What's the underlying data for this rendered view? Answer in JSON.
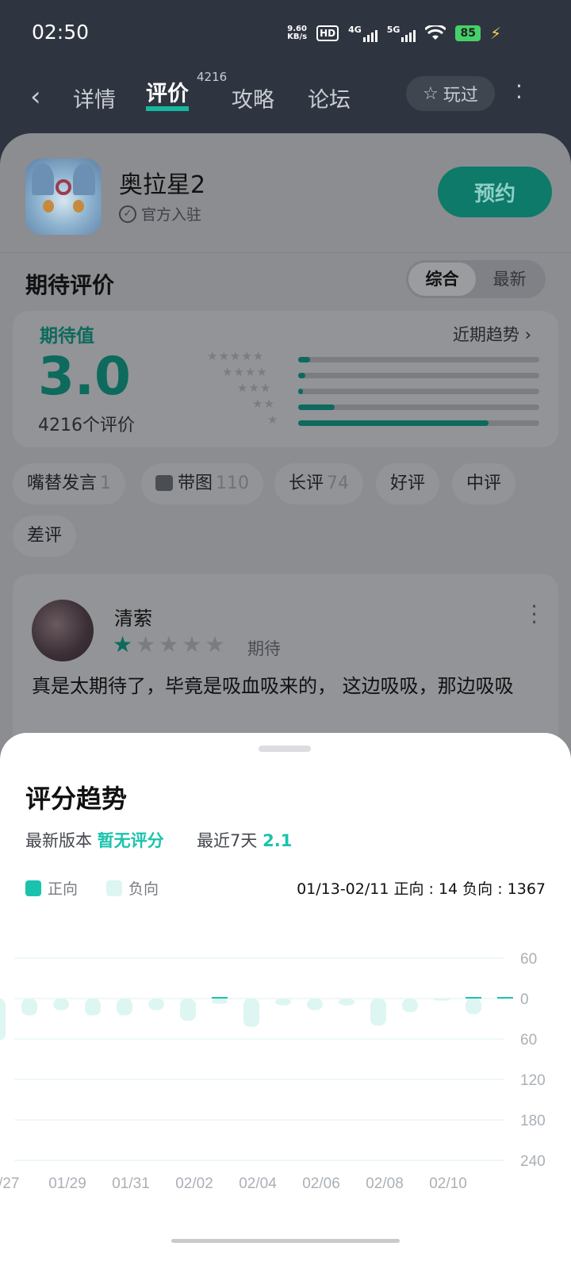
{
  "status": {
    "time": "02:50",
    "speed_value": "9.60",
    "speed_unit": "KB/s",
    "hd": "HD",
    "sim1": "4G",
    "sim2": "5G",
    "battery": "85"
  },
  "nav": {
    "tabs": [
      "详情",
      "评价",
      "攻略",
      "论坛"
    ],
    "active_tab": "评价",
    "review_count": "4216",
    "played_label": "玩过"
  },
  "game": {
    "name": "奥拉星2",
    "official": "官方入驻",
    "reserve_label": "预约"
  },
  "section": {
    "title": "期待评价",
    "sort_options": [
      "综合",
      "最新"
    ],
    "active_sort": "综合"
  },
  "rating": {
    "label": "期待值",
    "score": "3.0",
    "count_text": "4216个评价",
    "trend_link": "近期趋势",
    "distribution": [
      {
        "stars": 5,
        "fraction": 0.05
      },
      {
        "stars": 4,
        "fraction": 0.03
      },
      {
        "stars": 3,
        "fraction": 0.02
      },
      {
        "stars": 2,
        "fraction": 0.15
      },
      {
        "stars": 1,
        "fraction": 0.79
      }
    ]
  },
  "filters": [
    {
      "label": "嘴替发言",
      "count": "1"
    },
    {
      "label": "带图",
      "count": "110",
      "icon": "image-icon"
    },
    {
      "label": "长评",
      "count": "74"
    },
    {
      "label": "好评",
      "count": ""
    },
    {
      "label": "中评",
      "count": ""
    },
    {
      "label": "差评",
      "count": ""
    }
  ],
  "review": {
    "user": "清萦",
    "stars": 1,
    "tag": "期待",
    "text": "真是太期待了，毕竟是吸血吸来的， 这边吸吸，那边吸吸"
  },
  "sheet": {
    "title": "评分趋势",
    "latest_label": "最新版本",
    "latest_value": "暂无评分",
    "recent_label": "最近7天",
    "recent_value": "2.1",
    "legend_positive": "正向",
    "legend_negative": "负向",
    "stats": "01/13-02/11  正向 : 14   负向 : 1367",
    "colors": {
      "positive": "#1ac3ad",
      "negative": "#ddf6f2",
      "accent": "#1ac3ad"
    }
  },
  "chart_data": {
    "type": "bar",
    "x_tick_labels": [
      "/27",
      "01/29",
      "01/31",
      "02/02",
      "02/04",
      "02/06",
      "02/08",
      "02/10"
    ],
    "y_tick_labels": [
      "60",
      "0",
      "60",
      "120",
      "180",
      "240"
    ],
    "ylim": [
      -240,
      60
    ],
    "categories": [
      "01/26",
      "01/27",
      "01/28",
      "01/29",
      "01/30",
      "01/31",
      "02/01",
      "02/02",
      "02/03",
      "02/04",
      "02/05",
      "02/06",
      "02/07",
      "02/08",
      "02/09",
      "02/10",
      "02/11"
    ],
    "series": [
      {
        "name": "正向",
        "values": [
          0,
          0,
          0,
          0,
          0,
          0,
          0,
          1,
          0,
          0,
          0,
          0,
          0,
          0,
          0,
          1,
          1
        ]
      },
      {
        "name": "负向",
        "values": [
          -62,
          -25,
          -17,
          -25,
          -25,
          -17,
          -33,
          -8,
          -42,
          -10,
          -17,
          -10,
          -40,
          -20,
          -3,
          -23,
          0
        ]
      }
    ],
    "grid": true
  }
}
